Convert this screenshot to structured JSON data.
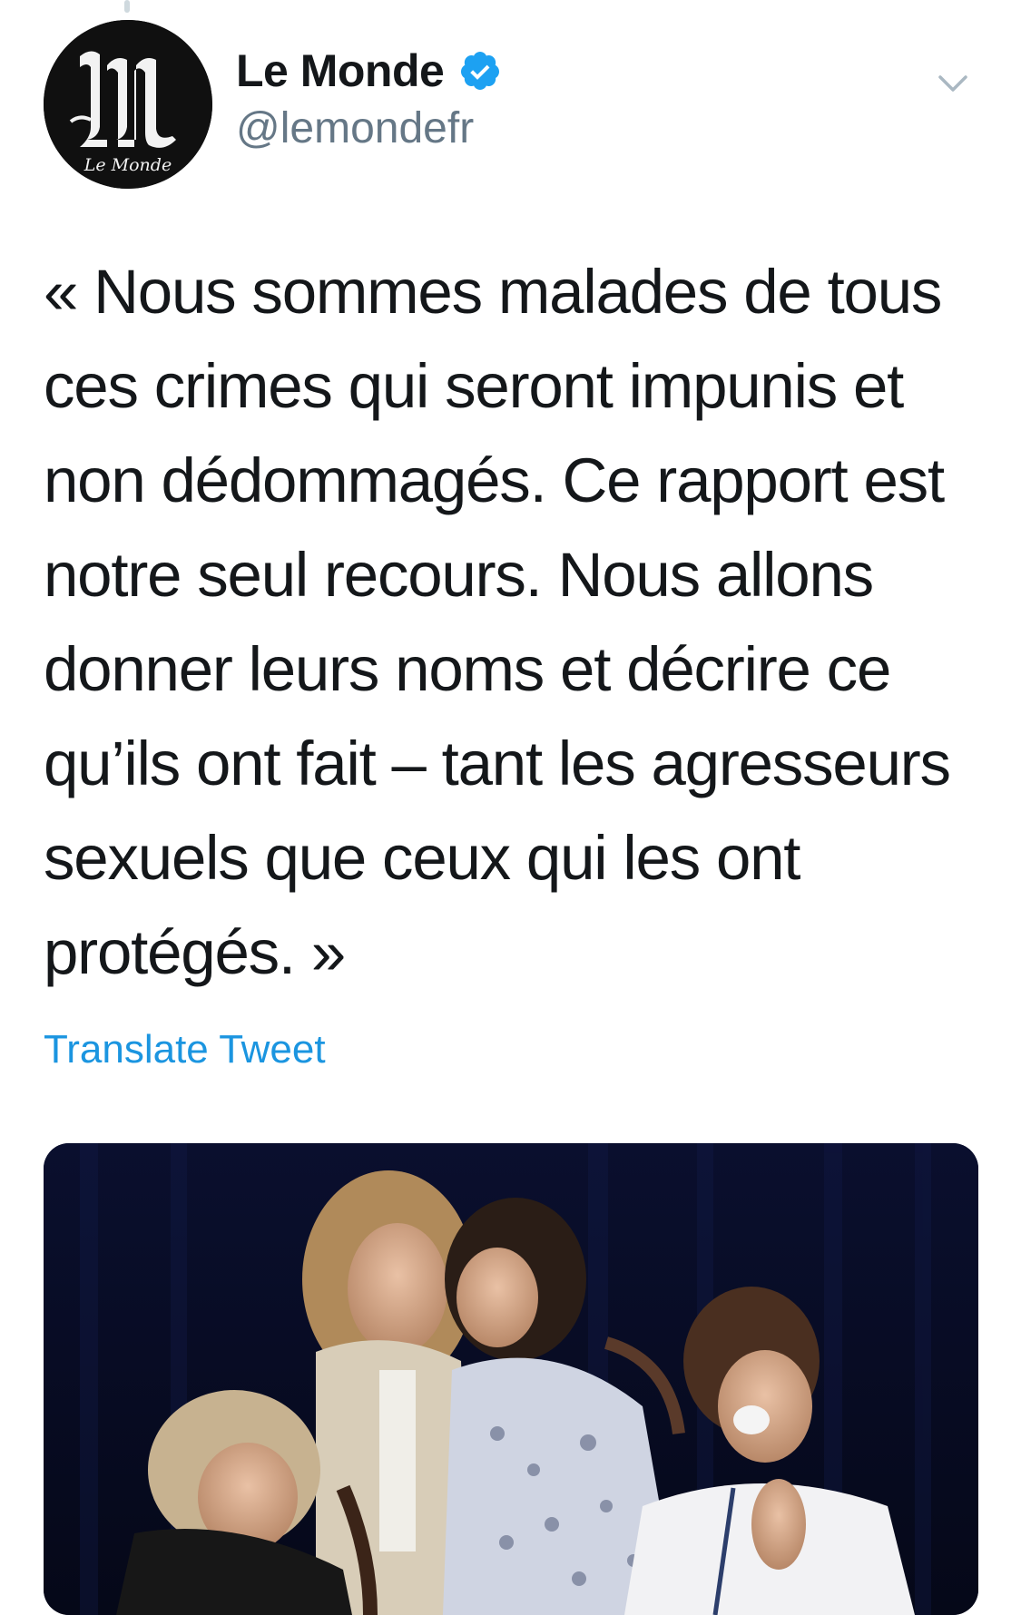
{
  "author": {
    "display_name": "Le Monde",
    "handle": "@lemondefr",
    "verified": true,
    "avatar_logo_text": "Le Monde"
  },
  "tweet": {
    "text": "« Nous sommes malades de tous\nces crimes qui seront impunis et\nnon dédommagés. Ce rapport est\nnotre seul recours. Nous allons\ndonner leurs noms et décrire ce\nqu’ils ont fait – tant les agresseurs\nsexuels que ceux qui les ont\nprotégés. »",
    "translate_label": "Translate Tweet"
  },
  "icons": {
    "verified": "verified-badge-icon",
    "menu": "chevron-down-icon"
  },
  "colors": {
    "link": "#1b95e0",
    "verified": "#1da1f2",
    "text": "#14171a",
    "secondary": "#657786"
  }
}
